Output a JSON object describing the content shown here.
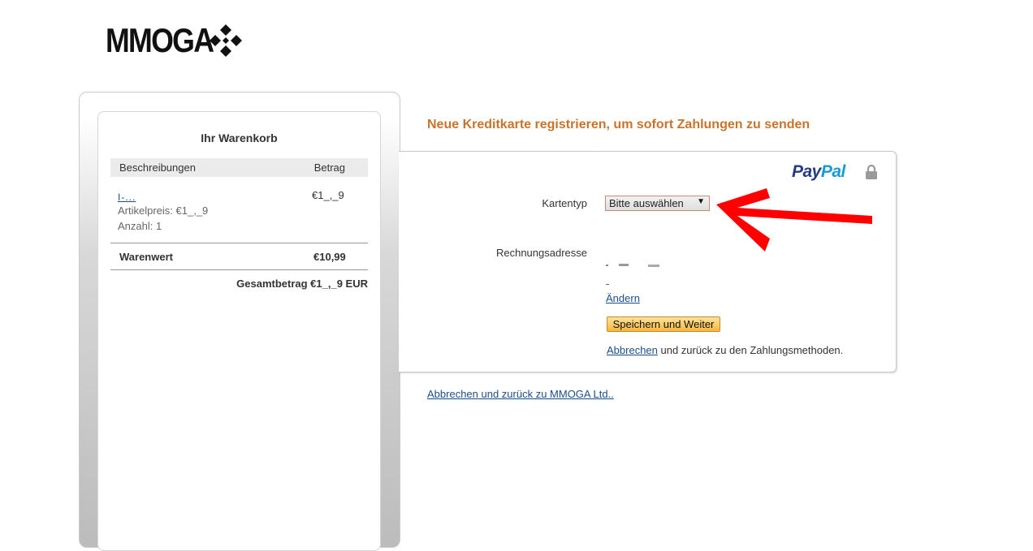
{
  "logo": {
    "text": "MMOGA"
  },
  "cart": {
    "title": "Ihr Warenkorb",
    "col_description": "Beschreibungen",
    "col_amount": "Betrag",
    "item": {
      "name": "I-...",
      "price": "€1_,_9",
      "unit_price": "Artikelpreis: €1_,_9",
      "quantity": "Anzahl: 1"
    },
    "subtotal_label": "Warenwert",
    "subtotal_value": "€10,99",
    "total": "Gesamtbetrag €1_,_9 EUR"
  },
  "headline": "Neue Kreditkarte registrieren, um sofort Zahlungen zu senden",
  "paypal": {
    "brand_part1": "Pay",
    "brand_part2": "Pal"
  },
  "form": {
    "card_type_label": "Kartentyp",
    "card_type_value": "Bitte auswählen",
    "billing_label": "Rechnungsadresse",
    "change_link": "Ändern",
    "save_button": "Speichern und Weiter",
    "cancel_link": "Abbrechen",
    "cancel_suffix": " und zurück zu den Zahlungsmethoden."
  },
  "footer_link": "Abbrechen und zurück zu MMOGA Ltd..",
  "colors": {
    "headline": "#c8742c",
    "link": "#1a4e8a",
    "paypal_dark": "#253b80",
    "paypal_light": "#179bd7",
    "annotation_arrow": "#ff0000"
  },
  "icons": [
    "mmoga-diamond-icon",
    "lock-icon",
    "dropdown-arrow-icon",
    "red-arrow-annotation"
  ]
}
